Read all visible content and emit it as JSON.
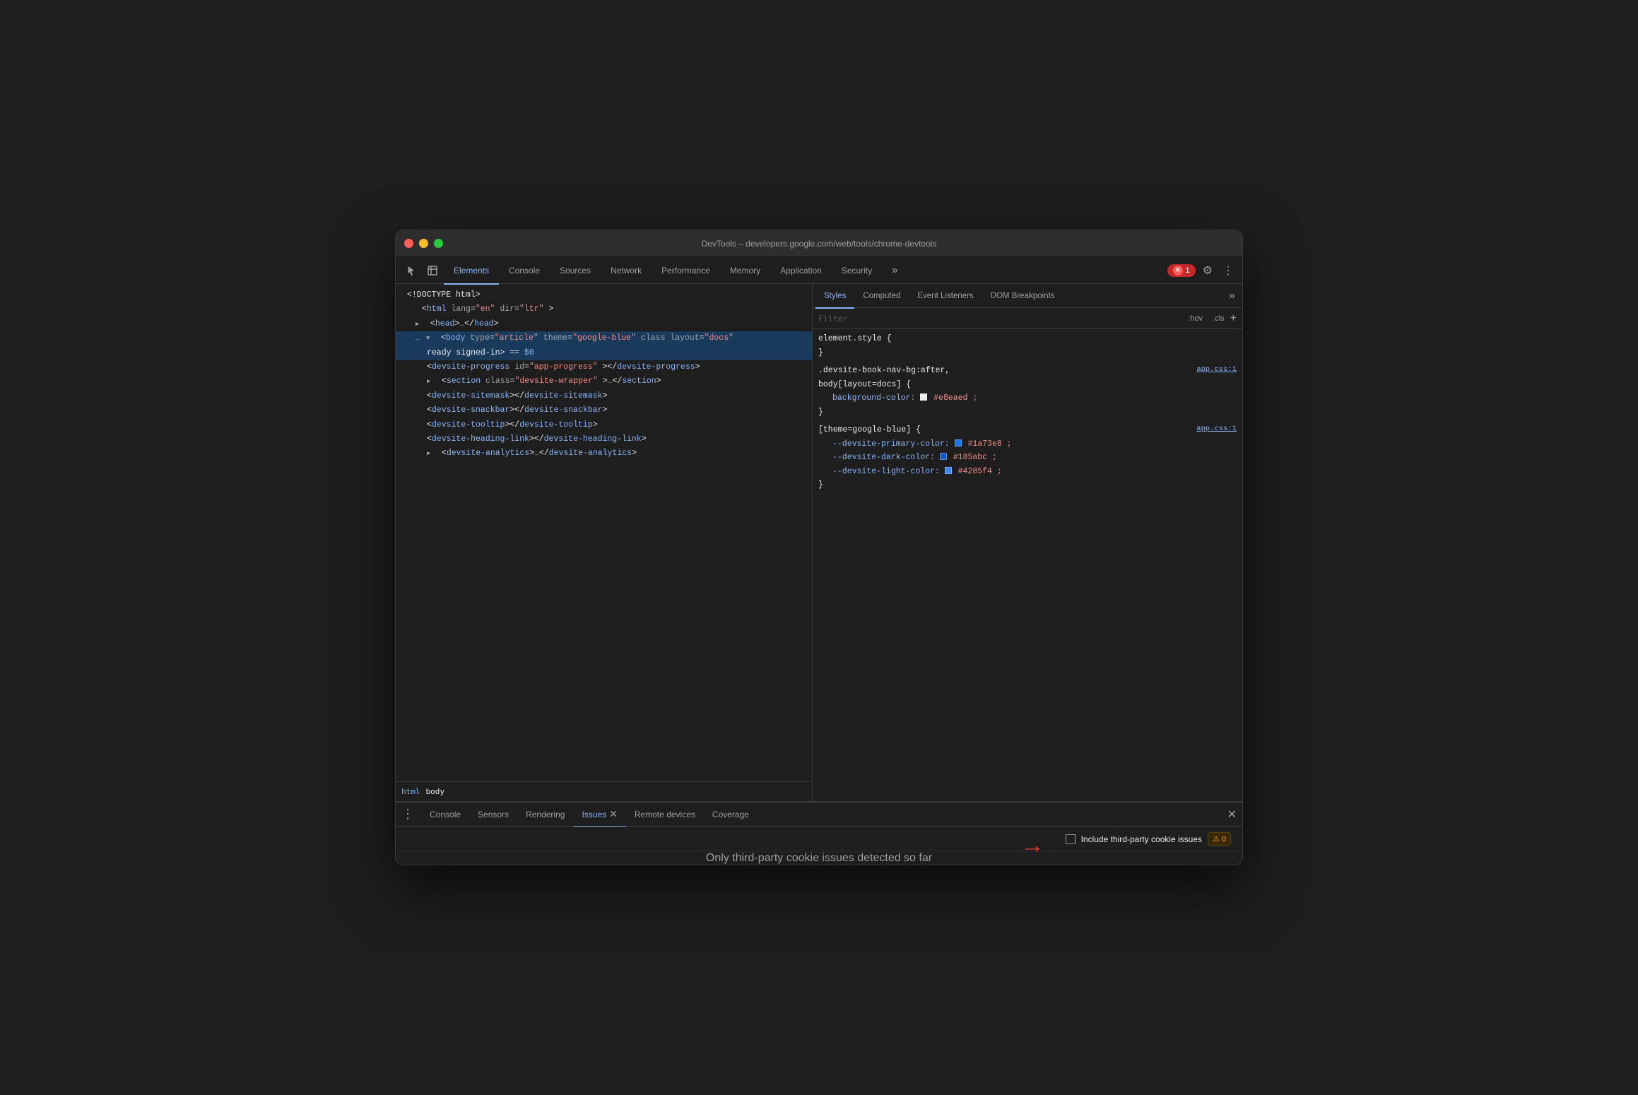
{
  "titlebar": {
    "title": "DevTools – developers.google.com/web/tools/chrome-devtools"
  },
  "devtools_tabs": {
    "tabs": [
      {
        "label": "Elements",
        "active": true
      },
      {
        "label": "Console",
        "active": false
      },
      {
        "label": "Sources",
        "active": false
      },
      {
        "label": "Network",
        "active": false
      },
      {
        "label": "Performance",
        "active": false
      },
      {
        "label": "Memory",
        "active": false
      },
      {
        "label": "Application",
        "active": false
      },
      {
        "label": "Security",
        "active": false
      }
    ],
    "error_count": "1",
    "settings_icon": "⚙",
    "more_icon": "⋮"
  },
  "dom_tree": {
    "lines": [
      {
        "text": "<!DOCTYPE html>",
        "indent": 0
      },
      {
        "text": "<html lang=\"en\" dir=\"ltr\">",
        "indent": 0
      },
      {
        "text": "▶ <head>…</head>",
        "indent": 1
      },
      {
        "text": "▼ <body type=\"article\" theme=\"google-blue\" class layout=\"docs\"",
        "indent": 1,
        "selected": true
      },
      {
        "text": "ready signed-in> == $0",
        "indent": 2,
        "selected": true
      },
      {
        "text": "<devsite-progress id=\"app-progress\"></devsite-progress>",
        "indent": 3
      },
      {
        "text": "▶ <section class=\"devsite-wrapper\">…</section>",
        "indent": 3
      },
      {
        "text": "<devsite-sitemask></devsite-sitemask>",
        "indent": 3
      },
      {
        "text": "<devsite-snackbar></devsite-snackbar>",
        "indent": 3
      },
      {
        "text": "<devsite-tooltip></devsite-tooltip>",
        "indent": 3
      },
      {
        "text": "<devsite-heading-link></devsite-heading-link>",
        "indent": 3
      },
      {
        "text": "▶ <devsite-analytics>…</devsite-analytics>",
        "indent": 3
      }
    ]
  },
  "breadcrumb": {
    "items": [
      "html",
      "body"
    ]
  },
  "styles_panel": {
    "tabs": [
      "Styles",
      "Computed",
      "Event Listeners",
      "DOM Breakpoints"
    ],
    "active_tab": "Styles",
    "filter_placeholder": "Filter",
    "filter_btns": [
      ":hov",
      ".cls"
    ],
    "rules": [
      {
        "selector": "element.style {",
        "close": "}",
        "props": []
      },
      {
        "selector": ".devsite-book-nav-bg:after,",
        "selector2": "body[layout=docs] {",
        "source": "app.css:1",
        "close": "}",
        "props": [
          {
            "name": "background-color:",
            "value": "#e8eaed",
            "swatch": "#e8eaed"
          }
        ]
      },
      {
        "selector": "[theme=google-blue] {",
        "source": "app.css:1",
        "close": "}",
        "props": [
          {
            "name": "--devsite-primary-color:",
            "value": "#1a73e8",
            "swatch": "#1a73e8"
          },
          {
            "name": "--devsite-dark-color:",
            "value": "#185abc",
            "swatch": "#185abc"
          },
          {
            "name": "--devsite-light-color:",
            "value": "#4285f4",
            "swatch": "#4285f4"
          }
        ]
      }
    ]
  },
  "drawer": {
    "tabs": [
      "Console",
      "Sensors",
      "Rendering",
      "Issues",
      "Remote devices",
      "Coverage"
    ],
    "active_tab": "Issues",
    "close_icon": "✕"
  },
  "issues_panel": {
    "checkbox_label": "Include third-party cookie issues",
    "warning_count": "0",
    "empty_message": "Only third-party cookie issues detected so far",
    "arrow_icon": "→"
  }
}
